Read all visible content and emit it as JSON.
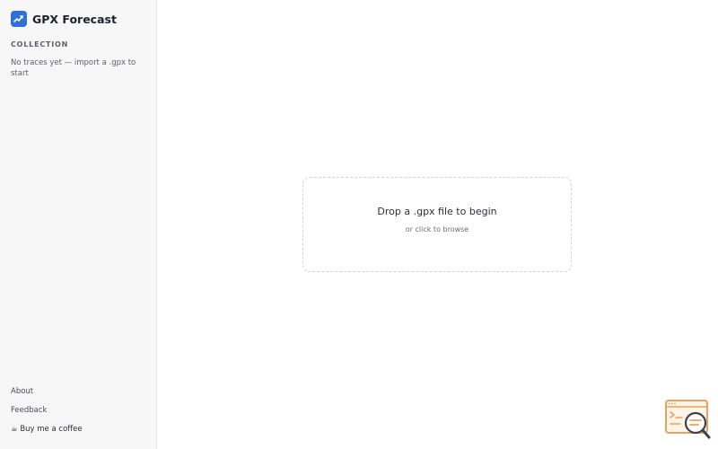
{
  "app": {
    "title": "GPX Forecast",
    "accent_color": "#2f6fd6",
    "logo_icon": "trend-chart-icon"
  },
  "sidebar": {
    "section_label": "COLLECTION",
    "empty_message": "No traces yet — import a .gpx to start",
    "footer": {
      "about": "About",
      "feedback": "Feedback",
      "coffee": "☕ Buy me a coffee"
    }
  },
  "dropzone": {
    "title": "Drop a .gpx file to begin",
    "subtitle": "or click to browse"
  },
  "corner_widget": {
    "icon": "code-window-search-icon",
    "color": "#e8a35a"
  }
}
